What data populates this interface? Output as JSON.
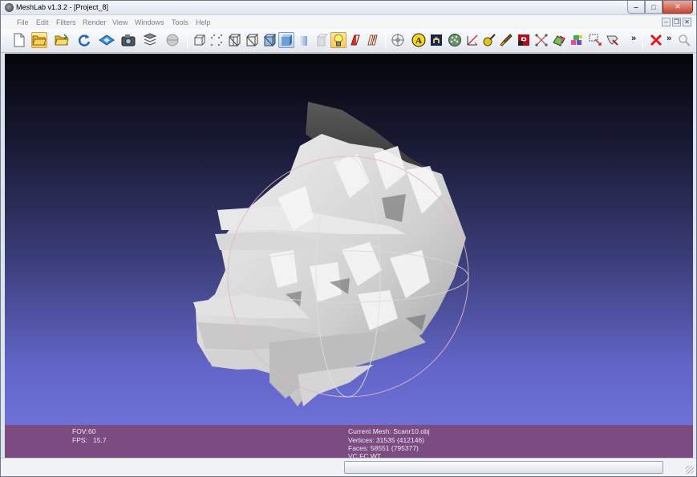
{
  "window": {
    "title": "MeshLab v1.3.2 - [Project_8]",
    "controls": {
      "minimize": "‒",
      "maximize": "□",
      "close": "✕"
    }
  },
  "menubar": {
    "items": [
      "File",
      "Edit",
      "Filters",
      "Render",
      "View",
      "Windows",
      "Tools",
      "Help"
    ],
    "mdi_controls": {
      "minimize": "–",
      "restore": "❐",
      "close": "✕"
    }
  },
  "toolbar": {
    "overflow_label": "»",
    "icons": [
      "new-project-icon",
      "open-project-icon",
      "import-mesh-icon",
      "reload-icon",
      "export-mesh-icon",
      "snapshot-icon",
      "layers-icon",
      "disabled-icon",
      "bounding-box-icon",
      "points-icon",
      "wireframe-icon",
      "hidden-lines-icon",
      "flat-lines-icon",
      "flat-icon",
      "smooth-icon",
      "back-face-icon",
      "light-icon",
      "color-icon",
      "texture-icon",
      "trackball-icon",
      "measure-icon",
      "info-icon",
      "align-icon",
      "paint-icon",
      "reference-icon",
      "point-picker-icon",
      "brush-icon",
      "raster-icon",
      "select-vertex-icon",
      "select-face-icon",
      "select-connected-icon",
      "edit-pick-icon",
      "close-icon",
      "search-icon"
    ]
  },
  "viewport": {
    "background_top": "#05050a",
    "background_bottom": "#6d70d6",
    "mesh_color": "#d9d9d9",
    "trackball_color": "#e8b8c8"
  },
  "info": {
    "fov_label": "FOV:",
    "fov_value": "60",
    "fps_label": "FPS:",
    "fps_value": "15.7",
    "current_mesh": "Current Mesh: Scanr10.obj",
    "vertices": "Vertices: 31535 (412146)",
    "faces": "Faces: 58551 (795377)",
    "flags": "VC FC WT"
  },
  "statusbar": {
    "progress": 0
  }
}
